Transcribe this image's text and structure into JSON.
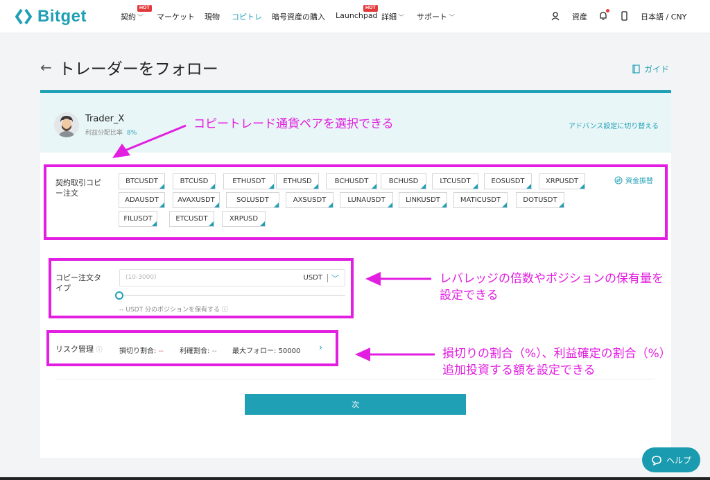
{
  "nav": {
    "brand": "Bitget",
    "items": [
      {
        "label": "契約",
        "hot": "HOT",
        "chev": "﹀"
      },
      {
        "label": "マーケット"
      },
      {
        "label": "現物"
      },
      {
        "label": "コピトレ"
      },
      {
        "label": "暗号資産の購入"
      },
      {
        "label": "Launchpad",
        "hot": "HOT"
      },
      {
        "label": "詳細",
        "chev": "﹀"
      },
      {
        "label": "サポート",
        "chev": "﹀"
      }
    ],
    "assets_label": "資産",
    "language": "日本語 / CNY"
  },
  "page": {
    "title": "トレーダーをフォロー",
    "guide_label": "ガイド"
  },
  "trader": {
    "name": "Trader_X",
    "profit_label": "利益分配比率",
    "profit_value": "8%",
    "advanced_link": "アドバンス設定に切り替える"
  },
  "contract": {
    "label_line1": "契約取引コピ",
    "label_line2": "ー注文",
    "transfer_label": "資金振替",
    "pairs": [
      "BTCUSDT",
      "BTCUSD",
      "ETHUSDT",
      "ETHUSD",
      "BCHUSDT",
      "BCHUSD",
      "LTCUSDT",
      "EOSUSDT",
      "XRPUSDT",
      "ADAUSDT",
      "AVAXUSDT",
      "SOLUSDT",
      "AXSUSDT",
      "LUNAUSDT",
      "LINKUSDT",
      "MATICUSDT",
      "DOTUSDT",
      "FILUSDT",
      "ETCUSDT",
      "XRPUSD"
    ]
  },
  "order_type": {
    "label_line1": "コピー注文タ",
    "label_line2": "イプ",
    "placeholder": "(10-3000)",
    "unit": "USDT",
    "hold_text": "-- USDT 分のポジションを保有する ⓘ"
  },
  "risk": {
    "label": "リスク管理",
    "stop_loss_label": "損切り割合:",
    "stop_loss_value": "--",
    "take_profit_label": "利確割合:",
    "take_profit_value": "--",
    "max_follow": "最大フォロー: 50000"
  },
  "next_button": "次",
  "annotations": {
    "pairs_note": "コピートレード通貨ペアを選択できる",
    "leverage_line1": "レバレッジの倍数やポジションの保有量を",
    "leverage_line2": "設定できる",
    "risk_line1": "損切りの割合（%）、利益確定の割合（%）",
    "risk_line2": "追加投資する額を設定できる"
  },
  "help_label": "ヘルプ",
  "colors": {
    "accent": "#1fa0b4",
    "annotation": "#e21ee0",
    "hot": "#e23b3b"
  }
}
